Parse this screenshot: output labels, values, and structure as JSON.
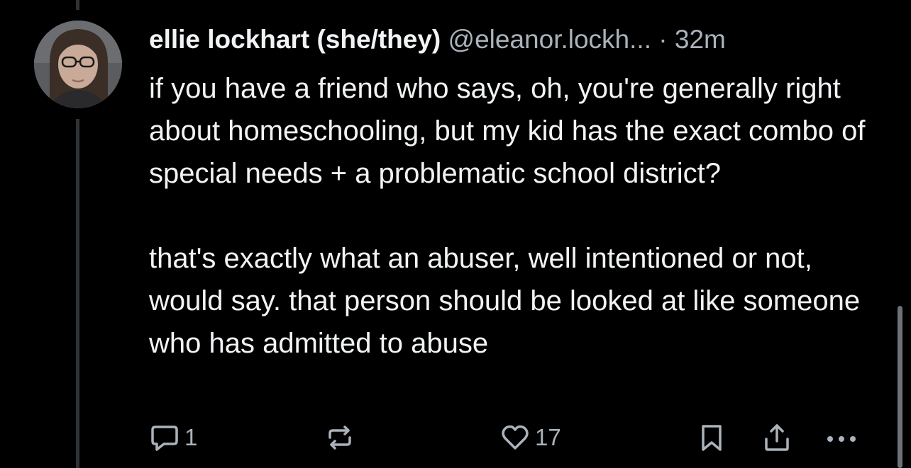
{
  "post": {
    "author": {
      "display_name": "ellie lockhart (she/they)",
      "handle": "@eleanor.lockh...",
      "avatar_icon": "user-avatar"
    },
    "separator": "·",
    "timestamp": "32m",
    "text": [
      "if you have a friend who says, oh, you're generally right about homeschooling, but my kid has the exact combo of special needs + a problematic school district?",
      "that's exactly what an abuser, well intentioned or not, would say. that person should be looked at like someone who has admitted to abuse"
    ],
    "actions": {
      "reply": {
        "icon": "reply-icon",
        "count": "1"
      },
      "repost": {
        "icon": "repost-icon"
      },
      "like": {
        "icon": "heart-icon",
        "count": "17"
      },
      "save": {
        "icon": "bookmark-icon"
      },
      "share": {
        "icon": "share-icon"
      },
      "more": {
        "icon": "more-icon"
      }
    }
  },
  "colors": {
    "background": "#000000",
    "primary_text": "#f1f3f5",
    "secondary_text": "#aab2bb",
    "thread_line": "#2e3338",
    "scrollbar": "#6d7278"
  }
}
